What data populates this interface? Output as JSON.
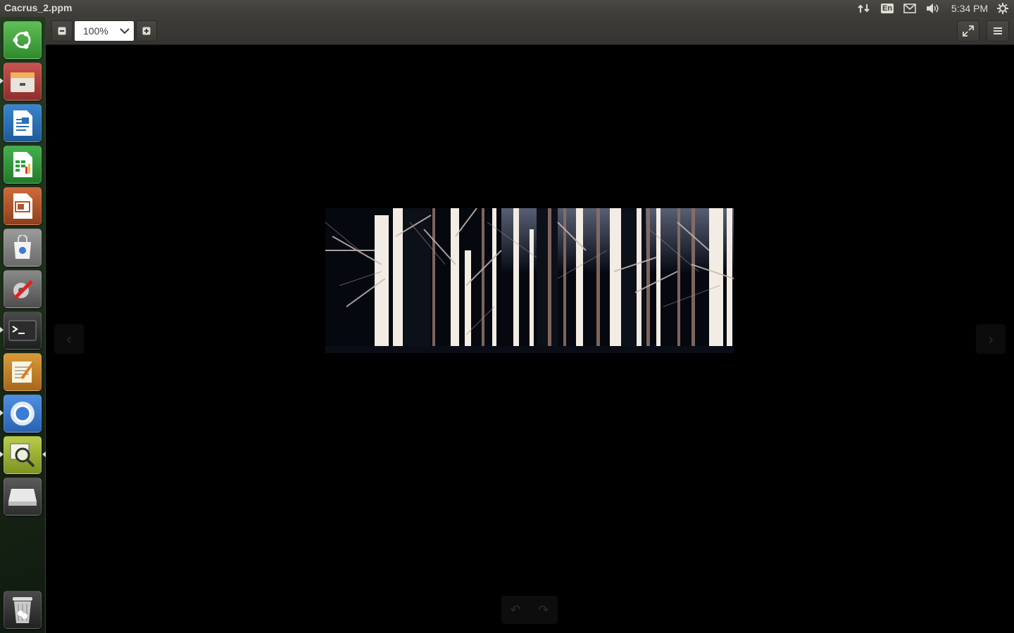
{
  "window": {
    "title": "Cacrus_2.ppm"
  },
  "top_panel": {
    "keyboard_layout": "En",
    "clock": "5:34 PM",
    "icons": [
      "network-updown-icon",
      "keyboard-layout-icon",
      "mail-icon",
      "volume-icon",
      "power-gear-icon"
    ]
  },
  "launcher": {
    "items": [
      {
        "name": "ubuntu-dash",
        "icon": "ubuntu-logo-icon",
        "color": "#3d9a3d",
        "running": false
      },
      {
        "name": "files",
        "icon": "file-cabinet-icon",
        "color": "#b0413e",
        "running": true
      },
      {
        "name": "libreoffice-writer",
        "icon": "writer-document-icon",
        "color": "#2b6fb4",
        "running": false
      },
      {
        "name": "libreoffice-calc",
        "icon": "calc-spreadsheet-icon",
        "color": "#2f9e3a",
        "running": false
      },
      {
        "name": "libreoffice-impress",
        "icon": "impress-presentation-icon",
        "color": "#b4552b",
        "running": false
      },
      {
        "name": "software-center",
        "icon": "shopping-bag-icon",
        "color": "#8a8a8a",
        "running": false
      },
      {
        "name": "system-settings",
        "icon": "settings-wrench-icon",
        "color": "#6e6e6e",
        "running": false
      },
      {
        "name": "terminal",
        "icon": "terminal-icon",
        "color": "#2b2b2b",
        "running": true
      },
      {
        "name": "text-editor",
        "icon": "notepad-pencil-icon",
        "color": "#c98a2d",
        "running": false
      },
      {
        "name": "chromium",
        "icon": "chromium-icon",
        "color": "#3a7bd5",
        "running": true
      },
      {
        "name": "image-viewer",
        "icon": "image-viewer-magnifier-icon",
        "color": "#9bb43a",
        "running": true,
        "active": true
      },
      {
        "name": "drive",
        "icon": "drive-icon",
        "color": "#cfcfcf",
        "running": false
      }
    ],
    "trash": {
      "name": "trash",
      "icon": "trash-icon"
    }
  },
  "toolbar": {
    "zoom_out": "−",
    "zoom_value": "100%",
    "zoom_in": "+",
    "fullscreen_icon": "fullscreen-icon",
    "menu_icon": "hamburger-menu-icon"
  },
  "viewer": {
    "image_alt": "Forest of birch trees",
    "prev_icon": "‹",
    "next_icon": "›",
    "rotate_left_icon": "↶",
    "rotate_right_icon": "↷"
  }
}
